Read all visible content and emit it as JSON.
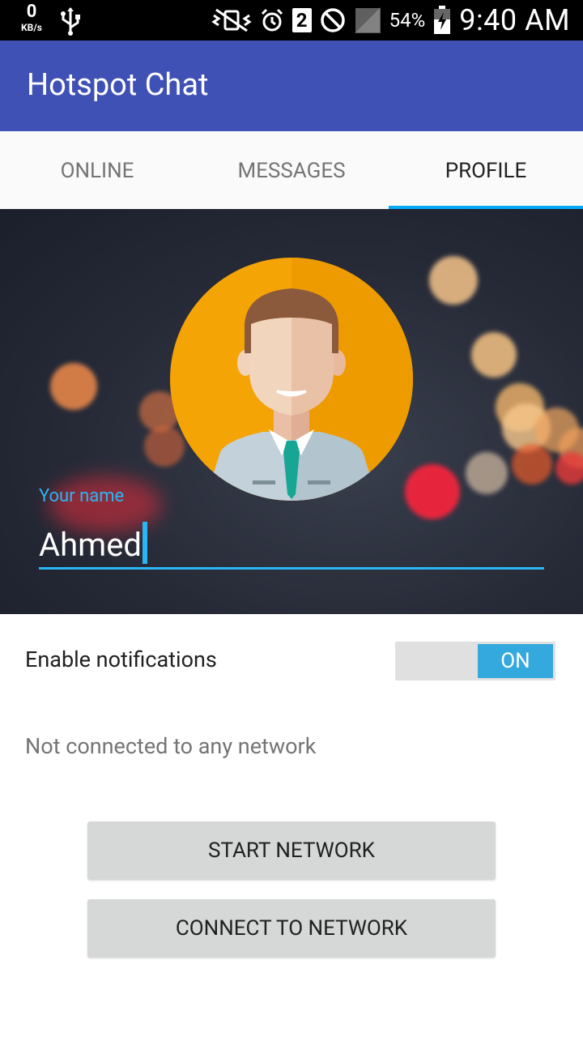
{
  "status_bar": {
    "speed_value": "0",
    "speed_unit": "KB/s",
    "sim_slot": "2",
    "battery_percent": "54%",
    "time": "9:40 AM",
    "icons": [
      "usb-icon",
      "vibrate-icon",
      "alarm-icon",
      "sim-icon",
      "do-not-disturb-icon",
      "signal-icon",
      "battery-icon"
    ]
  },
  "app_bar": {
    "title": "Hotspot Chat",
    "color": "#3f51b5"
  },
  "tabs": [
    {
      "label": "ONLINE"
    },
    {
      "label": "MESSAGES"
    },
    {
      "label": "PROFILE"
    }
  ],
  "active_tab": "PROFILE",
  "accent_color": "#03a9f4",
  "profile": {
    "name_label": "Your name",
    "name_value": "Ahmed",
    "avatar": "man-avatar-icon"
  },
  "settings": {
    "notifications_label": "Enable notifications",
    "notifications_toggle": "ON",
    "network_status": "Not connected to any network"
  },
  "buttons": {
    "start_network": "START NETWORK",
    "connect_network": "CONNECT TO NETWORK"
  }
}
